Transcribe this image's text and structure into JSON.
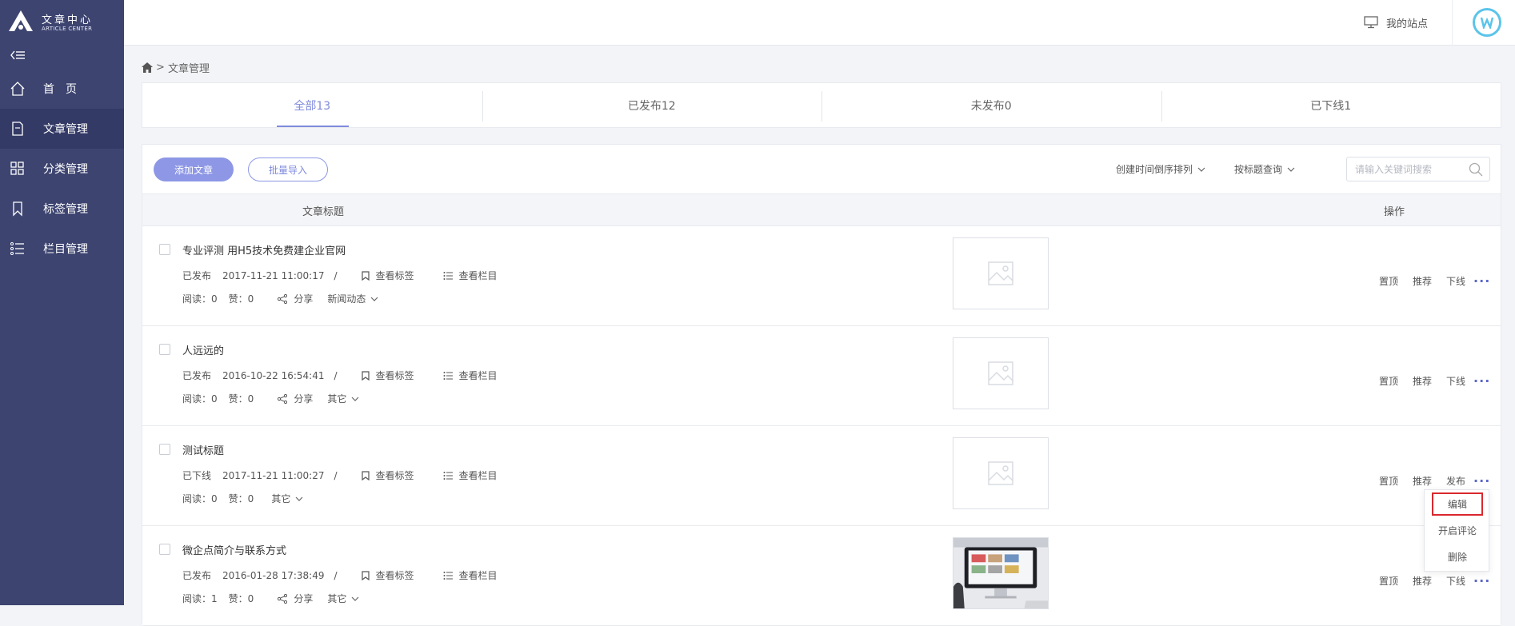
{
  "brand": {
    "name_cn": "文章中心",
    "name_en": "ARTICLE CENTER"
  },
  "sidebar": {
    "items": [
      {
        "label": "首　页",
        "icon": "home-icon"
      },
      {
        "label": "文章管理",
        "icon": "document-icon",
        "active": true
      },
      {
        "label": "分类管理",
        "icon": "grid-icon"
      },
      {
        "label": "标签管理",
        "icon": "bookmark-icon"
      },
      {
        "label": "栏目管理",
        "icon": "list-icon"
      }
    ]
  },
  "topbar": {
    "my_site": "我的站点"
  },
  "breadcrumb": {
    "separator": ">",
    "current": "文章管理"
  },
  "tabs": [
    {
      "label": "全部13",
      "active": true
    },
    {
      "label": "已发布12"
    },
    {
      "label": "未发布0"
    },
    {
      "label": "已下线1"
    }
  ],
  "toolbar": {
    "add_label": "添加文章",
    "import_label": "批量导入",
    "sort_label": "创建时间倒序排列",
    "query_label": "按标题查询",
    "search_placeholder": "请输入关键词搜索"
  },
  "table": {
    "col_title": "文章标题",
    "col_ops": "操作"
  },
  "labels": {
    "read": "阅读：",
    "like": "赞：",
    "view_tags": "查看标签",
    "view_column": "查看栏目",
    "share": "分享",
    "slash": "/",
    "top": "置顶",
    "recommend": "推荐"
  },
  "articles": [
    {
      "title": "专业评测 用H5技术免费建企业官网",
      "status": "已发布",
      "time": "2017-11-21 11:00:17",
      "reads": "0",
      "likes": "0",
      "share": true,
      "category": "新闻动态",
      "thumb": "placeholder",
      "action": "下线"
    },
    {
      "title": "人远远的",
      "status": "已发布",
      "time": "2016-10-22 16:54:41",
      "reads": "0",
      "likes": "0",
      "share": true,
      "category": "其它",
      "thumb": "placeholder",
      "action": "下线"
    },
    {
      "title": "测试标题",
      "status": "已下线",
      "time": "2017-11-21 11:00:27",
      "reads": "0",
      "likes": "0",
      "share": false,
      "category": "其它",
      "thumb": "placeholder",
      "action": "发布"
    },
    {
      "title": "微企点简介与联系方式",
      "status": "已发布",
      "time": "2016-01-28 17:38:49",
      "reads": "1",
      "likes": "0",
      "share": true,
      "category": "其它",
      "thumb": "photo",
      "action": "下线"
    }
  ],
  "more_menu": {
    "items": [
      "编辑",
      "开启评论",
      "删除"
    ],
    "highlighted": "编辑"
  },
  "colors": {
    "sidebar": "#3d4470",
    "accent": "#8d97e5",
    "highlight_border": "#d9282e"
  }
}
